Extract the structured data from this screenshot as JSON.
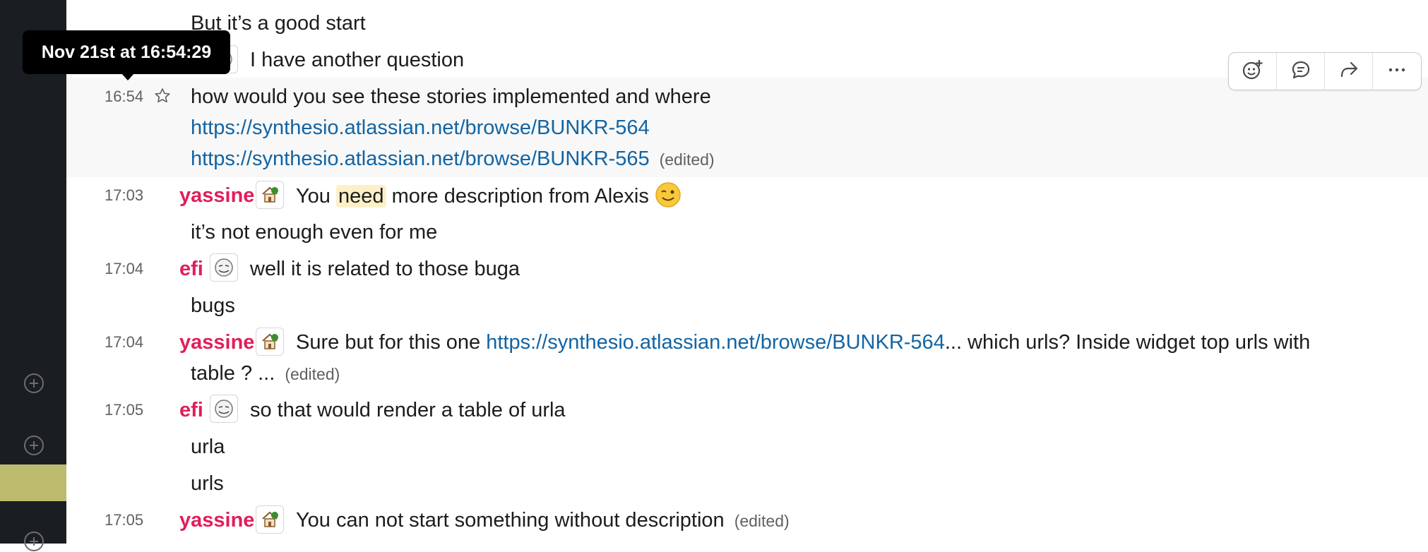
{
  "tooltip": {
    "text": "Nov 21st at 16:54:29"
  },
  "message_actions": {
    "add_reaction_icon": "emoji-add-icon",
    "reply_icon": "thread-reply-icon",
    "share_icon": "share-icon",
    "more_icon": "more-actions-icon"
  },
  "messages": {
    "m0": {
      "text": "But it’s a good start"
    },
    "m1": {
      "text": "I have another question"
    },
    "m2": {
      "time": "16:54",
      "text": "how would you see these stories implemented and where",
      "link1": "https://synthesio.atlassian.net/browse/BUNKR-564",
      "link2": "https://synthesio.atlassian.net/browse/BUNKR-565",
      "edited": "(edited)"
    },
    "m3": {
      "time": "17:03",
      "author": "yassine",
      "text_before": "You",
      "highlight": "need",
      "text_after": "more description from Alexis"
    },
    "m4": {
      "text": "it’s not enough even for me"
    },
    "m5": {
      "time": "17:04",
      "author": "efi",
      "text": "well it is related to those buga"
    },
    "m6": {
      "text": "bugs"
    },
    "m7": {
      "time": "17:04",
      "author": "yassine",
      "text_before": "Sure but for this one",
      "link": "https://synthesio.atlassian.net/browse/BUNKR-564",
      "text_after": "... which urls? Inside widget top urls with",
      "line2": "table ? ...",
      "edited": "(edited)"
    },
    "m8": {
      "time": "17:05",
      "author": "efi",
      "text": "so that would render a table of urla"
    },
    "m9": {
      "text": "urla"
    },
    "m10": {
      "text": "urls"
    },
    "m11": {
      "time": "17:05",
      "author": "yassine",
      "text": "You can not start something without description",
      "edited": "(edited)"
    }
  },
  "colors": {
    "sidebar": "#1a1d21",
    "author": "#e01e5a",
    "link": "#1264a3",
    "highlight": "#fdf0c8",
    "hover_row": "#f8f8f8"
  }
}
